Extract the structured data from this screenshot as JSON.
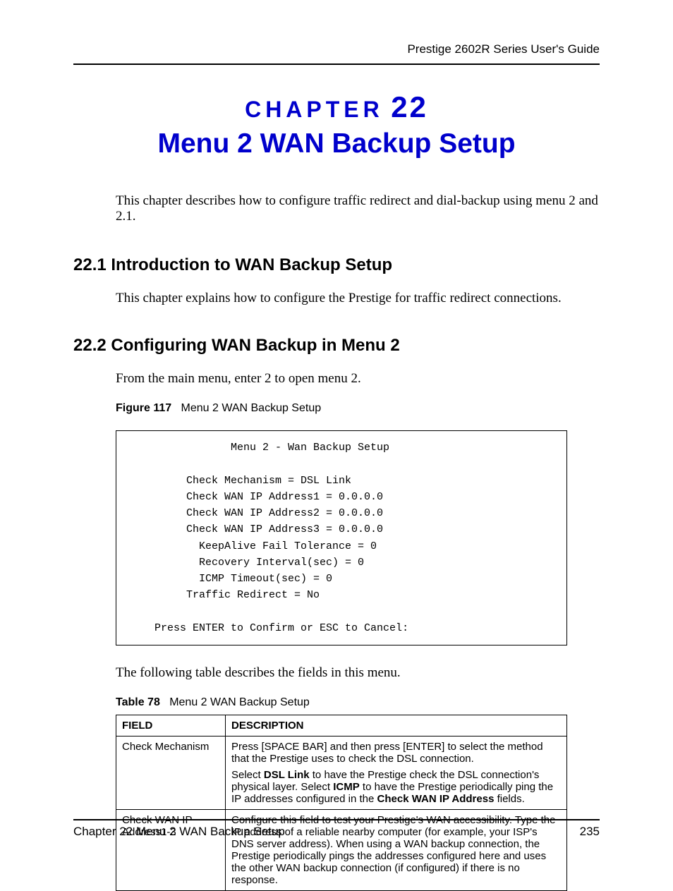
{
  "header": {
    "guide": "Prestige 2602R Series User's Guide"
  },
  "chapter": {
    "label_word": "CHAPTER",
    "label_num": "22",
    "title": "Menu 2 WAN Backup Setup",
    "intro": "This chapter describes how to configure traffic redirect and dial-backup using menu 2 and 2.1."
  },
  "s1": {
    "heading": "22.1  Introduction to WAN Backup Setup",
    "body": "This chapter explains how to configure the Prestige for traffic redirect connections."
  },
  "s2": {
    "heading": "22.2  Configuring WAN Backup in Menu 2",
    "body": "From the main menu, enter 2 to open menu 2.",
    "fig_label": "Figure 117",
    "fig_caption": "Menu 2 WAN Backup Setup",
    "terminal": "                Menu 2 - Wan Backup Setup\n\n         Check Mechanism = DSL Link\n         Check WAN IP Address1 = 0.0.0.0\n         Check WAN IP Address2 = 0.0.0.0\n         Check WAN IP Address3 = 0.0.0.0\n           KeepAlive Fail Tolerance = 0\n           Recovery Interval(sec) = 0\n           ICMP Timeout(sec) = 0\n         Traffic Redirect = No\n\n    Press ENTER to Confirm or ESC to Cancel:",
    "after_fig": "The following table describes the fields in this menu.",
    "tab_label": "Table 78",
    "tab_caption": "Menu 2 WAN Backup Setup",
    "table": {
      "h1": "FIELD",
      "h2": "DESCRIPTION",
      "r1": {
        "field": "Check Mechanism",
        "p1a": "Press [SPACE BAR] and then press [ENTER] to select the method that the Prestige uses to check the DSL connection.",
        "p2_pre": "Select ",
        "p2_b1": "DSL Link",
        "p2_mid": " to have the Prestige check the DSL connection's physical layer. Select ",
        "p2_b2": "ICMP",
        "p2_mid2": " to have the Prestige periodically ping the IP addresses configured in the ",
        "p2_b3": "Check WAN IP Address",
        "p2_end": " fields."
      },
      "r2": {
        "field": "Check WAN IP Address1-3",
        "p1": "Configure this field to test your Prestige's WAN accessibility. Type the IP address of a reliable nearby computer (for example, your ISP's DNS server address). When using a WAN backup connection, the Prestige periodically pings the addresses configured here and uses the other WAN backup connection (if configured) if there is no response."
      }
    }
  },
  "footer": {
    "left": "Chapter 22 Menu 2 WAN Backup Setup",
    "right": "235"
  }
}
